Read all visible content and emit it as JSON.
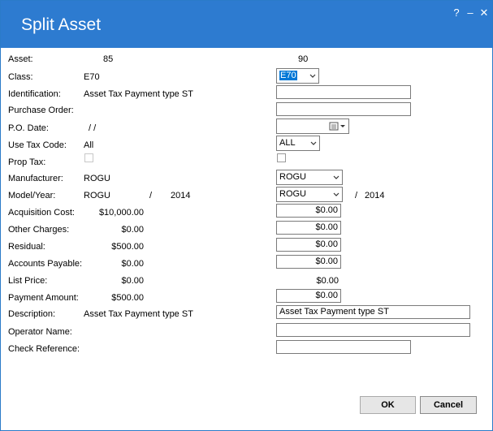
{
  "window": {
    "title": "Split Asset",
    "help": "?",
    "minimize": "–",
    "close": "✕"
  },
  "fields": {
    "asset": {
      "label": "Asset:",
      "orig": "85",
      "split": "90"
    },
    "class": {
      "label": "Class:",
      "orig": "E70",
      "split": "E70"
    },
    "identification": {
      "label": "Identification:",
      "orig": "Asset Tax Payment type ST",
      "split": ""
    },
    "purchase_order": {
      "label": "Purchase Order:",
      "orig": "",
      "split": ""
    },
    "po_date": {
      "label": "P.O. Date:",
      "orig": "/ /",
      "split": ""
    },
    "use_tax_code": {
      "label": "Use Tax Code:",
      "orig": "All",
      "split": "ALL"
    },
    "prop_tax": {
      "label": "Prop Tax:"
    },
    "manufacturer": {
      "label": "Manufacturer:",
      "orig": "ROGU",
      "split": "ROGU"
    },
    "model_year": {
      "label": "Model/Year:",
      "orig_model": "ROGU",
      "sep": "/",
      "orig_year": "2014",
      "split_model": "ROGU",
      "split_year": "2014"
    },
    "acquisition_cost": {
      "label": "Acquisition Cost:",
      "orig": "$10,000.00",
      "split": "$0.00"
    },
    "other_charges": {
      "label": "Other Charges:",
      "orig": "$0.00",
      "split": "$0.00"
    },
    "residual": {
      "label": "Residual:",
      "orig": "$500.00",
      "split": "$0.00"
    },
    "accounts_payable": {
      "label": "Accounts Payable:",
      "orig": "$0.00",
      "split": "$0.00"
    },
    "list_price": {
      "label": "List Price:",
      "orig": "$0.00",
      "split": "$0.00"
    },
    "payment_amount": {
      "label": "Payment Amount:",
      "orig": "$500.00",
      "split": "$0.00"
    },
    "description": {
      "label": "Description:",
      "orig": "Asset Tax Payment type ST",
      "split": "Asset Tax Payment type ST"
    },
    "operator_name": {
      "label": "Operator Name:",
      "split": ""
    },
    "check_reference": {
      "label": "Check Reference:",
      "split": ""
    }
  },
  "buttons": {
    "ok": "OK",
    "cancel": "Cancel"
  },
  "colors": {
    "titlebar": "#2d7bd0",
    "selection": "#0078d7"
  }
}
